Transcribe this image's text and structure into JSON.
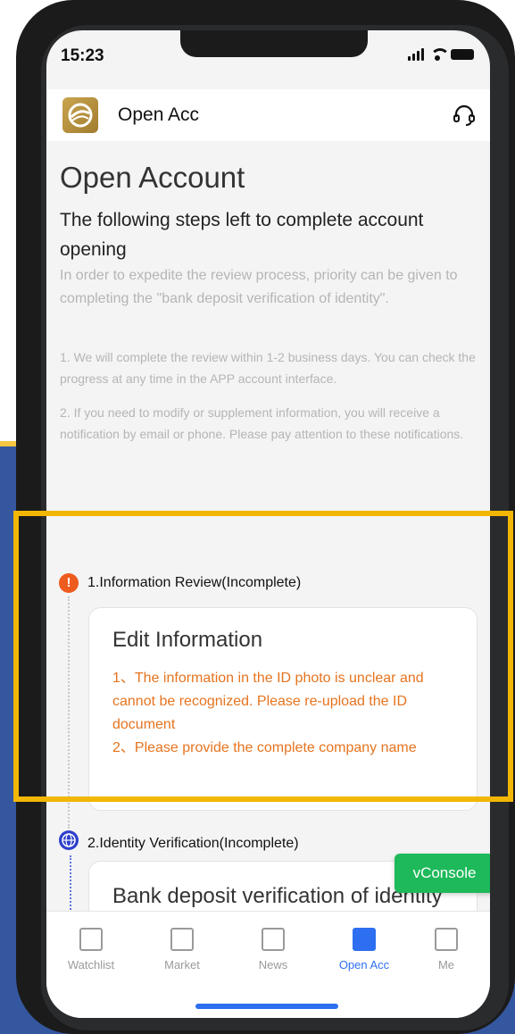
{
  "status_bar": {
    "time": "15:23"
  },
  "nav": {
    "title": "Open Acc",
    "logo_icon": "app-logo-icon",
    "support_icon": "headset-icon"
  },
  "page": {
    "title": "Open Account",
    "subtitle": "The following steps left to complete account opening",
    "intro": "In order to expedite the review process, priority can be given to completing the \"bank deposit verification of identity\".",
    "note1": "1. We will complete the review within 1-2 business days. You can check the progress at any time in the APP account interface.",
    "note2": "2. If you need to modify or supplement information, you will receive a notification by email or phone. Please pay attention to these notifications."
  },
  "steps": [
    {
      "title": "1.Information Review(Incomplete)",
      "status_icon": "!",
      "card_title": "Edit Information",
      "issues": [
        "1、The information in the ID photo is unclear and cannot be recognized. Please re-upload the ID document",
        "2、Please provide the complete company name"
      ]
    },
    {
      "title": "2.Identity Verification(Incomplete)",
      "status_icon": "globe-icon",
      "card_title": "Bank deposit verification of identity"
    }
  ],
  "vconsole": {
    "label": "vConsole"
  },
  "tabs": [
    {
      "label": "Watchlist",
      "icon": "chart-line-icon"
    },
    {
      "label": "Market",
      "icon": "bar-chart-icon"
    },
    {
      "label": "News",
      "icon": "news-icon"
    },
    {
      "label": "Open Acc",
      "icon": "transfer-icon",
      "active": true
    },
    {
      "label": "Me",
      "icon": "profile-icon"
    }
  ],
  "colors": {
    "accent_blue": "#2d6ff0",
    "warning_orange": "#e6741f",
    "highlight_yellow": "#f2b705",
    "vconsole_green": "#1db95a"
  }
}
